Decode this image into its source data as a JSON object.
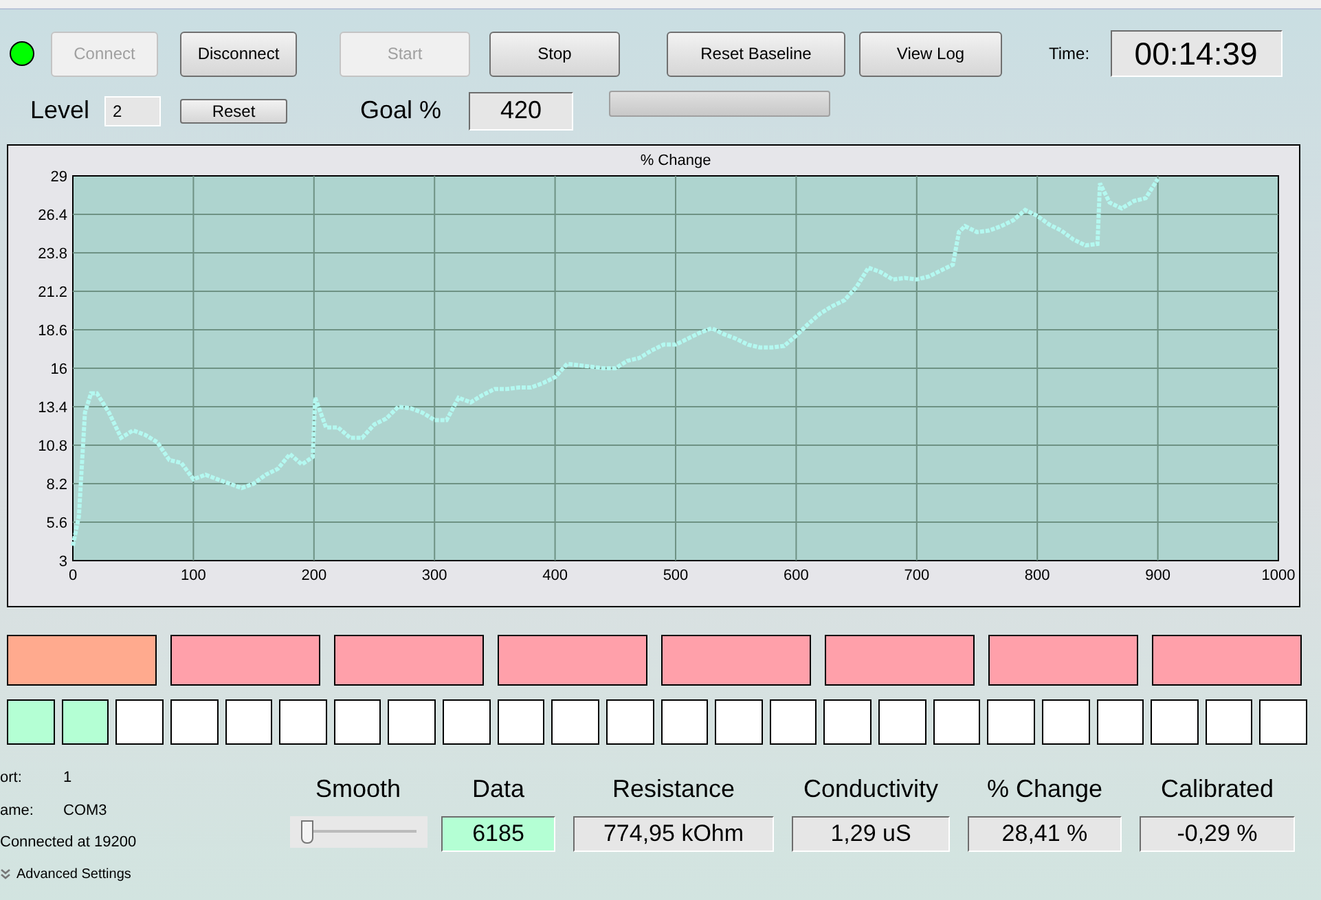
{
  "status_led": {
    "on": true
  },
  "buttons": [
    {
      "label": "Connect",
      "disabled": true
    },
    {
      "label": "Disconnect",
      "disabled": false
    },
    {
      "label": "Start",
      "disabled": true
    },
    {
      "label": "Stop",
      "disabled": false
    },
    {
      "label": "Reset Baseline",
      "disabled": false
    },
    {
      "label": "View Log",
      "disabled": false
    }
  ],
  "time": {
    "label": "Time:",
    "value": "00:14:39"
  },
  "level": {
    "label": "Level",
    "value": "2",
    "reset": "Reset"
  },
  "goal": {
    "label": "Goal %",
    "value": "420",
    "progress": {
      "level": 0
    }
  },
  "chart": {
    "chart_data": {
      "type": "line",
      "title": "% Change",
      "grid": true,
      "xlim": [
        0,
        1000
      ],
      "ylim": [
        3,
        29
      ],
      "xticks": [
        0,
        100,
        200,
        300,
        400,
        500,
        600,
        700,
        800,
        900,
        1000
      ],
      "yticks": [
        3,
        5.6,
        8.2,
        10.8,
        13.4,
        16,
        18.6,
        21.2,
        23.8,
        26.4,
        29
      ],
      "x": [
        0,
        5,
        10,
        15,
        20,
        30,
        40,
        50,
        60,
        70,
        80,
        90,
        100,
        110,
        120,
        130,
        140,
        150,
        160,
        170,
        180,
        190,
        199,
        201,
        210,
        220,
        230,
        240,
        250,
        260,
        270,
        280,
        290,
        300,
        310,
        320,
        330,
        340,
        350,
        360,
        370,
        380,
        390,
        400,
        410,
        420,
        430,
        440,
        450,
        460,
        470,
        480,
        490,
        500,
        510,
        520,
        530,
        540,
        550,
        560,
        570,
        580,
        590,
        600,
        610,
        620,
        630,
        640,
        650,
        660,
        670,
        680,
        690,
        700,
        710,
        720,
        730,
        735,
        740,
        750,
        760,
        770,
        780,
        790,
        800,
        810,
        820,
        830,
        840,
        850,
        852,
        860,
        870,
        880,
        890,
        900
      ],
      "series": [
        {
          "color": "#b4f8f0",
          "line_style": "dotted",
          "values": [
            4,
            6,
            13,
            14.3,
            14.3,
            13,
            11.3,
            11.8,
            11.5,
            11,
            9.8,
            9.6,
            8.5,
            8.8,
            8.5,
            8.2,
            7.9,
            8.2,
            8.8,
            9.2,
            10.2,
            9.5,
            10,
            14,
            12,
            12,
            11.3,
            11.3,
            12.2,
            12.6,
            13.4,
            13.3,
            13,
            12.5,
            12.5,
            14,
            13.7,
            14.2,
            14.6,
            14.6,
            14.7,
            14.7,
            15,
            15.4,
            16.3,
            16.2,
            16.1,
            16,
            16,
            16.5,
            16.7,
            17.2,
            17.6,
            17.6,
            18,
            18.4,
            18.7,
            18.3,
            18,
            17.6,
            17.4,
            17.4,
            17.5,
            18.2,
            19,
            19.7,
            20.2,
            20.6,
            21.5,
            22.8,
            22.5,
            22,
            22.1,
            22,
            22.2,
            22.6,
            23,
            25.2,
            25.6,
            25.2,
            25.3,
            25.6,
            26,
            26.7,
            26.3,
            25.7,
            25.3,
            24.7,
            24.3,
            24.4,
            28.5,
            27.2,
            26.8,
            27.3,
            27.5,
            28.8
          ]
        }
      ]
    }
  },
  "blocks": [
    {
      "color": "#ffaa8e"
    },
    {
      "color": "#ffa0aa"
    },
    {
      "color": "#ffa0aa"
    },
    {
      "color": "#ffa0aa"
    },
    {
      "color": "#ffa0aa"
    },
    {
      "color": "#ffa0aa"
    },
    {
      "color": "#ffa0aa"
    },
    {
      "color": "#ffa0aa"
    }
  ],
  "squares": [
    {
      "color": "#b4ffd4"
    },
    {
      "color": "#b4ffd4"
    },
    {
      "color": "#ffffff"
    },
    {
      "color": "#ffffff"
    },
    {
      "color": "#ffffff"
    },
    {
      "color": "#ffffff"
    },
    {
      "color": "#ffffff"
    },
    {
      "color": "#ffffff"
    },
    {
      "color": "#ffffff"
    },
    {
      "color": "#ffffff"
    },
    {
      "color": "#ffffff"
    },
    {
      "color": "#ffffff"
    },
    {
      "color": "#ffffff"
    },
    {
      "color": "#ffffff"
    },
    {
      "color": "#ffffff"
    },
    {
      "color": "#ffffff"
    },
    {
      "color": "#ffffff"
    },
    {
      "color": "#ffffff"
    },
    {
      "color": "#ffffff"
    },
    {
      "color": "#ffffff"
    },
    {
      "color": "#ffffff"
    },
    {
      "color": "#ffffff"
    },
    {
      "color": "#ffffff"
    },
    {
      "color": "#ffffff"
    }
  ],
  "port_info": [
    {
      "label": "ort:",
      "value": "1"
    },
    {
      "label": "ame:",
      "value": "COM3"
    },
    {
      "label": "Connected at 19200"
    }
  ],
  "advanced_settings": {
    "label": "Advanced Settings",
    "expanded": false
  },
  "smooth": {
    "label": "Smooth",
    "level": 0.05
  },
  "readouts": [
    {
      "label": "Data",
      "value": "6185",
      "highlighted": true
    },
    {
      "label": "Resistance",
      "value": "774,95 kOhm",
      "highlighted": false
    },
    {
      "label": "Conductivity",
      "value": "1,29 uS",
      "highlighted": false
    },
    {
      "label": "% Change",
      "value": "28,41 %",
      "highlighted": false
    },
    {
      "label": "Calibrated",
      "value": "-0,29 %",
      "highlighted": false
    }
  ]
}
